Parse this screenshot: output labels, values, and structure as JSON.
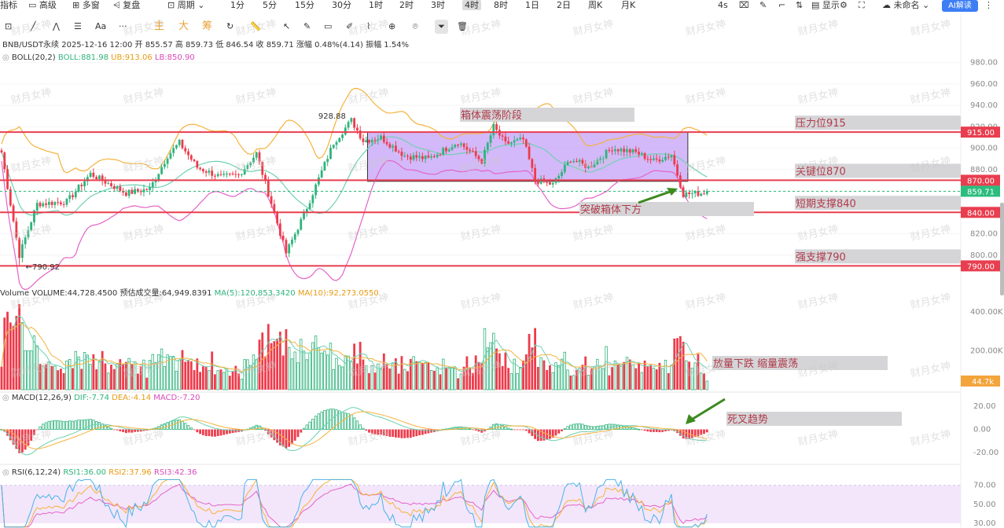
{
  "toolbar": {
    "items": [
      "指标",
      "高级",
      "多窗",
      "复盘",
      "周期",
      "1分",
      "5分",
      "15分",
      "30分",
      "1时",
      "2时",
      "3时",
      "4时",
      "8时",
      "1日",
      "2日",
      "周K",
      "月K"
    ],
    "active_index": 12,
    "right_items": [
      "4s",
      "显示",
      "未命名"
    ],
    "ai_label": "AI解读"
  },
  "tools": {
    "labels": [
      "Aa"
    ],
    "modes": [
      "主",
      "大",
      "筹"
    ]
  },
  "info": {
    "line1": "BNB/USDT永续 2025-12-16 12:00 开 855.57 高 859.73 低 846.54 收 859.71 涨幅 0.48%(4.14) 振幅 1.54%",
    "boll_label": "BOLL(20,2)",
    "boll_value": "BOLL:881.98",
    "boll_ub": "UB:913.06",
    "boll_lb": "LB:850.90",
    "vol_label": "Volume",
    "vol_value": "VOLUME:44,728.4500",
    "vol_forecast": "预估成交量:64,949.8391",
    "vol_ma5": "MA(5):120,853.3420",
    "vol_ma10": "MA(10):92,273.0550",
    "macd_label": "MACD(12,26,9)",
    "macd_dif": "DIF:-7.74",
    "macd_dea": "DEA:-4.14",
    "macd_val": "MACD:-7.20",
    "rsi_label": "RSI(6,12,24)",
    "rsi1": "RSI1:36.00",
    "rsi2": "RSI2:37.96",
    "rsi3": "RSI3:42.36"
  },
  "colors": {
    "up": "#2fb37c",
    "down": "#ee3b4b",
    "level_line": "#e83e4f",
    "boll_mid": "#6fd0b3",
    "boll_ub": "#f6b23b",
    "boll_lb": "#e463c7",
    "box_fill": "#c7a5f7",
    "last_price": "#2bbd7e",
    "vol_price": "#f3a43a",
    "arrow": "#3d8a1f"
  },
  "chart_data": [
    {
      "type": "candlestick",
      "pane": "price",
      "ylim": [
        780,
        990
      ],
      "yticks": [
        800,
        820,
        840,
        860,
        880,
        900,
        920,
        940,
        960,
        980
      ],
      "ytick_labels": [
        "800.00",
        "820.00",
        "840.00",
        "860.00",
        "880.00",
        "900.00",
        "920.00",
        "940.00",
        "960.00",
        "980.00"
      ],
      "levels": [
        {
          "value": 915,
          "label": "915.00",
          "annotation": "压力位915"
        },
        {
          "value": 870,
          "label": "870.00",
          "annotation": "关键位870"
        },
        {
          "value": 840,
          "label": "840.00",
          "annotation": "短期支撑840"
        },
        {
          "value": 790,
          "label": "790.00",
          "annotation": "强支撑790"
        }
      ],
      "last_price": {
        "value": 859.71,
        "label": "859.71"
      },
      "high_mark": {
        "value": 928.88,
        "label": "928.88"
      },
      "low_mark": {
        "value": 790.92,
        "label": "790.92"
      },
      "box": {
        "y_top": 915,
        "y_bottom": 869,
        "annotation": "箱体震荡阶段"
      },
      "breakdown_annotation": "突破箱体下方",
      "anchors": [
        {
          "i": 0,
          "p": 896
        },
        {
          "i": 6,
          "p": 800
        },
        {
          "i": 12,
          "p": 848
        },
        {
          "i": 22,
          "p": 850
        },
        {
          "i": 30,
          "p": 876
        },
        {
          "i": 42,
          "p": 858
        },
        {
          "i": 50,
          "p": 862
        },
        {
          "i": 56,
          "p": 893
        },
        {
          "i": 60,
          "p": 905
        },
        {
          "i": 66,
          "p": 882
        },
        {
          "i": 74,
          "p": 873
        },
        {
          "i": 80,
          "p": 875
        },
        {
          "i": 86,
          "p": 895
        },
        {
          "i": 90,
          "p": 858
        },
        {
          "i": 96,
          "p": 802
        },
        {
          "i": 102,
          "p": 838
        },
        {
          "i": 112,
          "p": 905
        },
        {
          "i": 118,
          "p": 926
        },
        {
          "i": 122,
          "p": 907
        },
        {
          "i": 128,
          "p": 910
        },
        {
          "i": 136,
          "p": 893
        },
        {
          "i": 144,
          "p": 890
        },
        {
          "i": 154,
          "p": 906
        },
        {
          "i": 162,
          "p": 888
        },
        {
          "i": 166,
          "p": 920
        },
        {
          "i": 170,
          "p": 904
        },
        {
          "i": 176,
          "p": 908
        },
        {
          "i": 180,
          "p": 870
        },
        {
          "i": 186,
          "p": 866
        },
        {
          "i": 192,
          "p": 890
        },
        {
          "i": 198,
          "p": 882
        },
        {
          "i": 206,
          "p": 900
        },
        {
          "i": 214,
          "p": 896
        },
        {
          "i": 220,
          "p": 888
        },
        {
          "i": 226,
          "p": 894
        },
        {
          "i": 230,
          "p": 857
        },
        {
          "i": 236,
          "p": 858
        },
        {
          "i": 238,
          "p": 859.71
        }
      ]
    },
    {
      "type": "bar",
      "pane": "volume",
      "ylim": [
        0,
        460000
      ],
      "yticks": [
        200000,
        400000
      ],
      "ytick_labels": [
        "200.00K",
        "400.00K"
      ],
      "current": {
        "value": 44728,
        "label": "44.7k"
      },
      "annotation": "放量下跌 缩量震荡"
    },
    {
      "type": "bar",
      "pane": "macd",
      "ylim": [
        -28,
        28
      ],
      "yticks": [
        -20,
        0,
        20
      ],
      "ytick_labels": [
        "-20.00",
        "0.00",
        "20.00"
      ],
      "annotation": "死叉趋势"
    },
    {
      "type": "line",
      "pane": "rsi",
      "ylim": [
        25,
        78
      ],
      "yticks": [
        30,
        50,
        70
      ],
      "ytick_labels": [
        "30.00",
        "50.00",
        "70.00"
      ]
    }
  ],
  "watermark": "财月女神"
}
